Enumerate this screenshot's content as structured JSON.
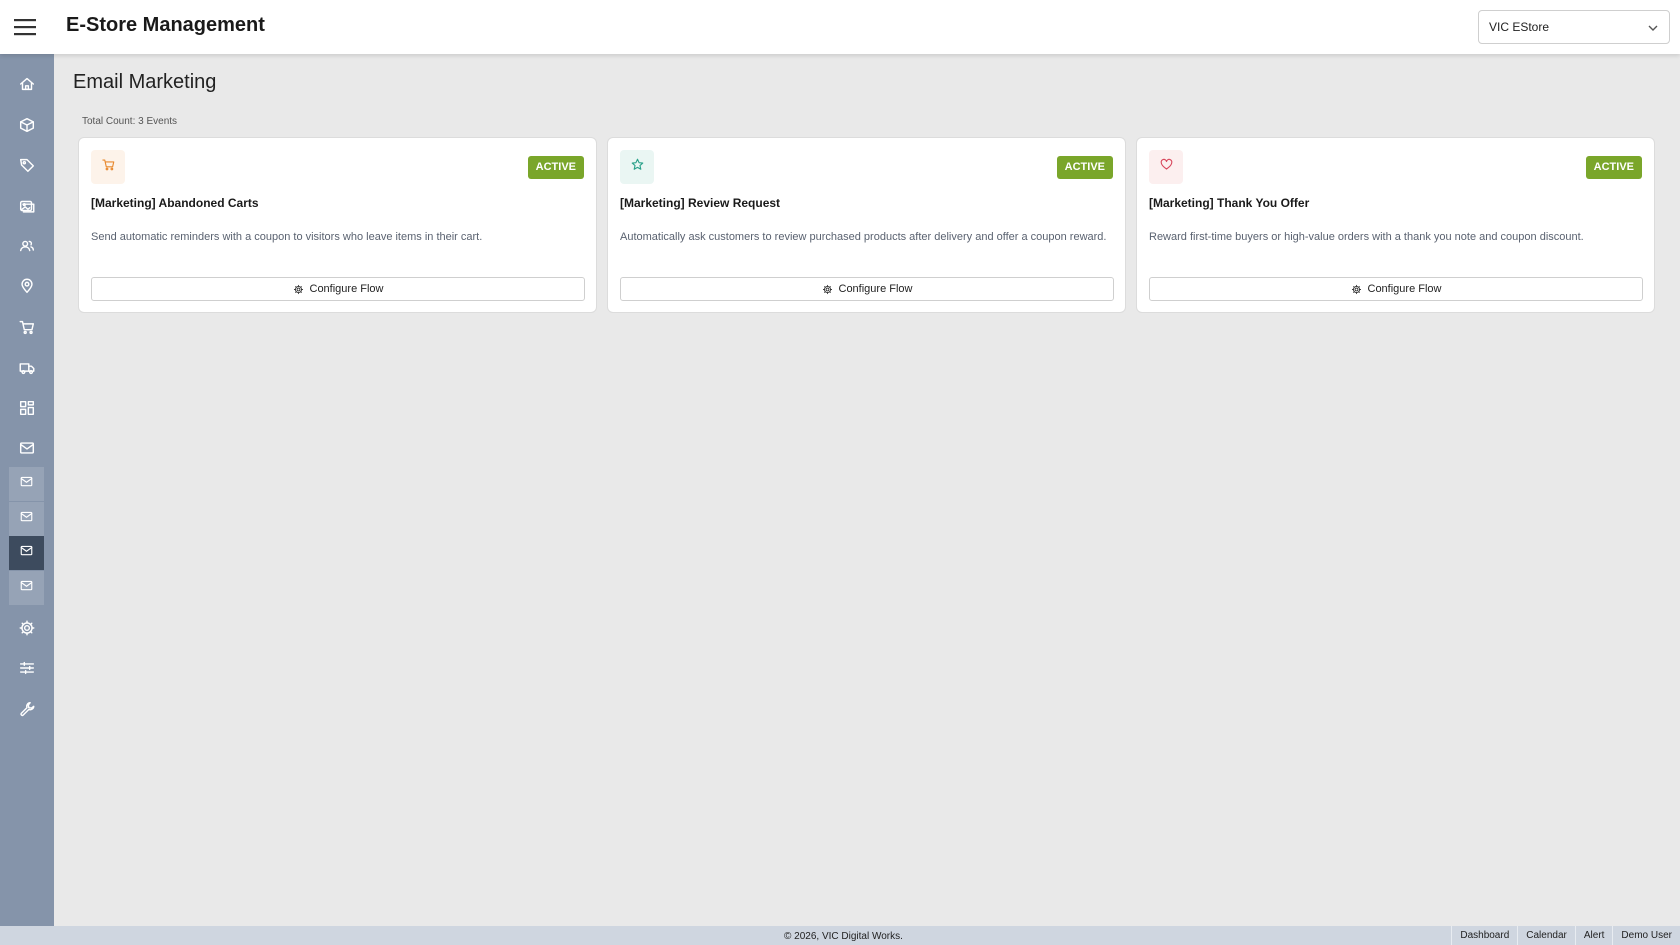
{
  "header": {
    "app_title": "E-Store Management",
    "store_select": "VIC EStore"
  },
  "sidebar": {
    "items": [
      {
        "icon": "home-icon"
      },
      {
        "icon": "box-icon"
      },
      {
        "icon": "tag-icon"
      },
      {
        "icon": "image-icon"
      },
      {
        "icon": "users-icon"
      },
      {
        "icon": "location-icon"
      },
      {
        "icon": "cart-icon"
      },
      {
        "icon": "truck-icon"
      },
      {
        "icon": "layout-icon"
      },
      {
        "icon": "mail-icon"
      }
    ],
    "subitems": [
      {
        "icon": "mail-icon",
        "active": false
      },
      {
        "icon": "mail-icon",
        "active": false
      },
      {
        "icon": "mail-icon",
        "active": true
      },
      {
        "icon": "mail-icon",
        "active": false
      }
    ],
    "bottom_items": [
      {
        "icon": "gear-icon"
      },
      {
        "icon": "sliders-icon"
      },
      {
        "icon": "wrench-icon"
      }
    ]
  },
  "main": {
    "page_title": "Email Marketing",
    "total_count": "Total Count: 3 Events",
    "cards": [
      {
        "icon": "cart-icon",
        "icon_color": "#e8892e",
        "icon_bg": "#fdf3ea",
        "status": "ACTIVE",
        "title": "[Marketing] Abandoned Carts",
        "description": "Send automatic reminders with a coupon to visitors who leave items in their cart.",
        "button_label": "Configure Flow"
      },
      {
        "icon": "star-icon",
        "icon_color": "#2aa18a",
        "icon_bg": "#eaf6f3",
        "status": "ACTIVE",
        "title": "[Marketing] Review Request",
        "description": "Automatically ask customers to review purchased products after delivery and offer a coupon reward.",
        "button_label": "Configure Flow"
      },
      {
        "icon": "heart-icon",
        "icon_color": "#d8485d",
        "icon_bg": "#fcefef",
        "status": "ACTIVE",
        "title": "[Marketing] Thank You Offer",
        "description": "Reward first-time buyers or high-value orders with a thank you note and coupon discount.",
        "button_label": "Configure Flow"
      }
    ]
  },
  "footer": {
    "copyright": "© 2026, VIC Digital Works.",
    "links": [
      "Dashboard",
      "Calendar",
      "Alert",
      "Demo User"
    ]
  },
  "colors": {
    "sidebar_bg": "#8594aa",
    "active_badge": "#7aa62a",
    "active_sidebar_item": "#3d4b5e"
  }
}
